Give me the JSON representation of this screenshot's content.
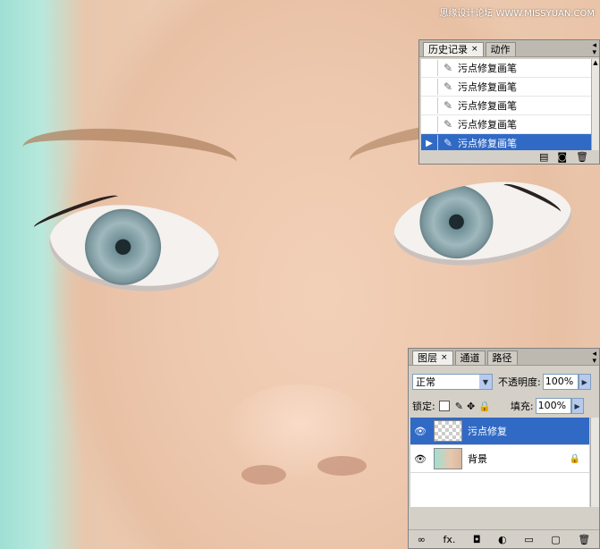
{
  "watermark": "思缘设计论坛 WWW.MISSYUAN.COM",
  "history": {
    "tabs": [
      {
        "label": "历史记录",
        "active": true,
        "close": "×"
      },
      {
        "label": "动作",
        "active": false
      }
    ],
    "items": [
      {
        "label": "污点修复画笔",
        "icon": "spot-healing-brush-icon",
        "selected": false
      },
      {
        "label": "污点修复画笔",
        "icon": "spot-healing-brush-icon",
        "selected": false
      },
      {
        "label": "污点修复画笔",
        "icon": "spot-healing-brush-icon",
        "selected": false
      },
      {
        "label": "污点修复画笔",
        "icon": "spot-healing-brush-icon",
        "selected": false
      },
      {
        "label": "污点修复画笔",
        "icon": "spot-healing-brush-icon",
        "selected": true
      }
    ]
  },
  "layers": {
    "tabs": [
      {
        "label": "图层",
        "active": true,
        "close": "×"
      },
      {
        "label": "通道",
        "active": false
      },
      {
        "label": "路径",
        "active": false
      }
    ],
    "blend_mode": "正常",
    "opacity_label": "不透明度:",
    "opacity_value": "100%",
    "lock_label": "锁定:",
    "fill_label": "填充:",
    "fill_value": "100%",
    "items": [
      {
        "name": "污点修复",
        "selected": true,
        "thumb": "transparent"
      },
      {
        "name": "背景",
        "selected": false,
        "thumb": "photo",
        "locked": true
      }
    ],
    "footer": {
      "fx": "fx."
    }
  },
  "colors": {
    "selection": "#316ac5",
    "panel": "#d4d0c8"
  }
}
